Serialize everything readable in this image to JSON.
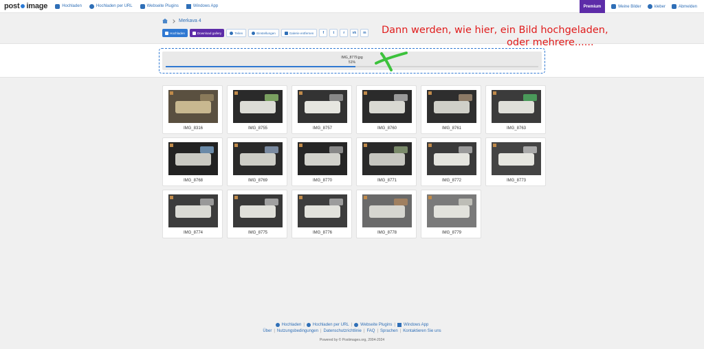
{
  "nav": {
    "logo_left": "post",
    "logo_right": "image",
    "left_items": [
      {
        "label": "Hochladen",
        "icon": "cloud-upload-icon"
      },
      {
        "label": "Hochladen per URL",
        "icon": "globe-icon"
      },
      {
        "label": "Webseite Plugins",
        "icon": "puzzle-icon"
      },
      {
        "label": "Windows App",
        "icon": "windows-icon"
      }
    ],
    "premium": "Premium",
    "right_items": [
      {
        "label": "Meine Bilder",
        "icon": "image-icon"
      },
      {
        "label": "kleber",
        "icon": "user-icon"
      },
      {
        "label": "Abmelden",
        "icon": "logout-icon"
      }
    ]
  },
  "breadcrumb": {
    "gallery": "Merkava 4"
  },
  "toolbar": {
    "upload": "Hochladen",
    "download": "Download gallery",
    "share": "Teilen",
    "settings": "Einstellungen",
    "delete": "Galerie entfernen",
    "social": [
      "f",
      "t",
      "r",
      "vk",
      "m"
    ]
  },
  "annotation": {
    "line1": "Dann werden, wie hier, ein Bild hochgeladen,",
    "line2": "oder mehrere......"
  },
  "upload": {
    "filename": "IMG_8779.jpg",
    "percent_label": "51%",
    "progress": 0.51
  },
  "images": [
    {
      "name": "IMG_8316"
    },
    {
      "name": "IMG_8755"
    },
    {
      "name": "IMG_8757"
    },
    {
      "name": "IMG_8760"
    },
    {
      "name": "IMG_8761"
    },
    {
      "name": "IMG_8763"
    },
    {
      "name": "IMG_8768"
    },
    {
      "name": "IMG_8769"
    },
    {
      "name": "IMG_8770"
    },
    {
      "name": "IMG_8771"
    },
    {
      "name": "IMG_8772"
    },
    {
      "name": "IMG_8773"
    },
    {
      "name": "IMG_8774"
    },
    {
      "name": "IMG_8775"
    },
    {
      "name": "IMG_8776"
    },
    {
      "name": "IMG_8778"
    },
    {
      "name": "IMG_8779"
    }
  ],
  "footer": {
    "row1": [
      "Hochladen",
      "Hochladen per URL",
      "Webseite Plugins",
      "Windows App"
    ],
    "row2": [
      "Über",
      "Nutzungsbedingungen",
      "Datenschutzrichtlinie",
      "FAQ",
      "Sprachen",
      "Kontaktieren Sie uns"
    ],
    "copyright": "Powered by © Postimages.org, 2004-2024"
  },
  "colors": {
    "accent": "#2f78d2",
    "premium": "#5d2ca8",
    "annotation": "#e01b1b"
  }
}
